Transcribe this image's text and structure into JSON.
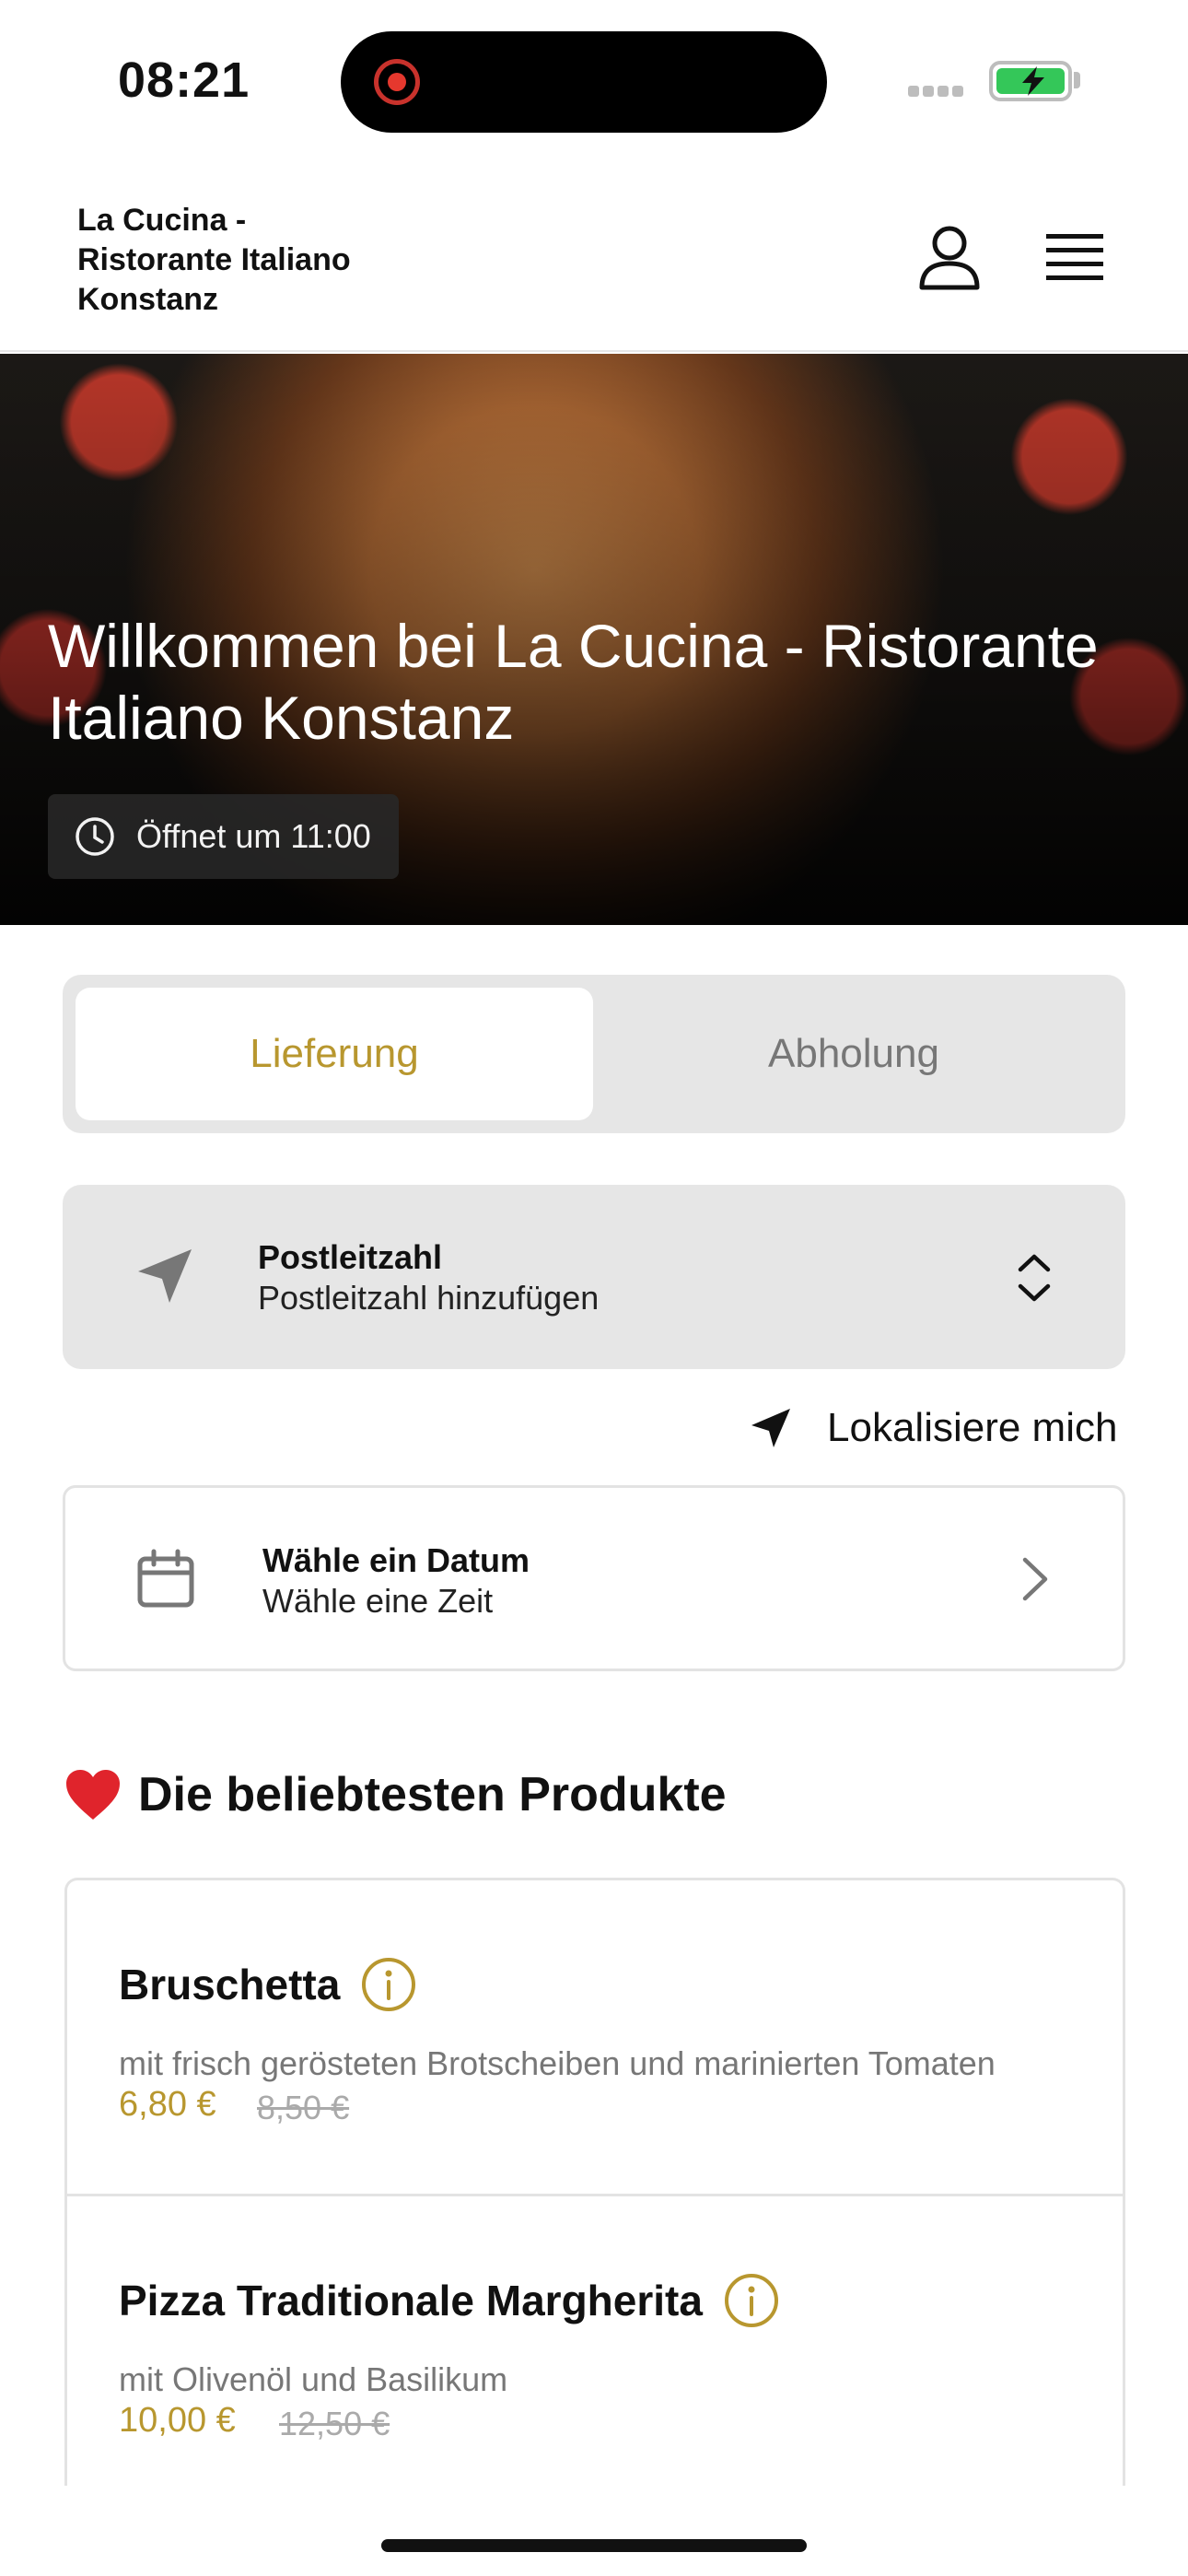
{
  "status_bar": {
    "time": "08:21"
  },
  "header": {
    "brand_line1": "La Cucina -",
    "brand_line2": "Ristorante Italiano",
    "brand_line3": "Konstanz"
  },
  "hero": {
    "title": "Willkommen bei La Cucina - Ristorante Italiano Konstanz",
    "hours": "Öffnet um 11:00"
  },
  "order_mode": {
    "options": [
      "Lieferung",
      "Abholung"
    ],
    "selected": "Lieferung"
  },
  "postcode": {
    "label": "Postleitzahl",
    "placeholder": "Postleitzahl hinzufügen"
  },
  "locate_label": "Lokalisiere mich",
  "date_picker": {
    "title": "Wähle ein Datum",
    "subtitle": "Wähle eine Zeit"
  },
  "popular": {
    "heading": "Die beliebtesten Produkte",
    "products": [
      {
        "name": "Bruschetta",
        "description": "mit frisch gerösteten Brotscheiben und marinierten Tomaten",
        "price": "6,80 €",
        "old_price": "8,50 €"
      },
      {
        "name": "Pizza Traditionale Margherita",
        "description": "mit Olivenöl und Basilikum",
        "price": "10,00 €",
        "old_price": "12,50 €"
      }
    ]
  },
  "colors": {
    "accent": "#b8972f",
    "segment_bg": "#e6e6e6",
    "battery": "#34c759"
  },
  "icons": [
    "user-icon",
    "menu-icon",
    "clock-icon",
    "location-arrow-icon",
    "updown-chevron-icon",
    "calendar-icon",
    "chevron-right-icon",
    "heart-icon",
    "info-icon"
  ]
}
